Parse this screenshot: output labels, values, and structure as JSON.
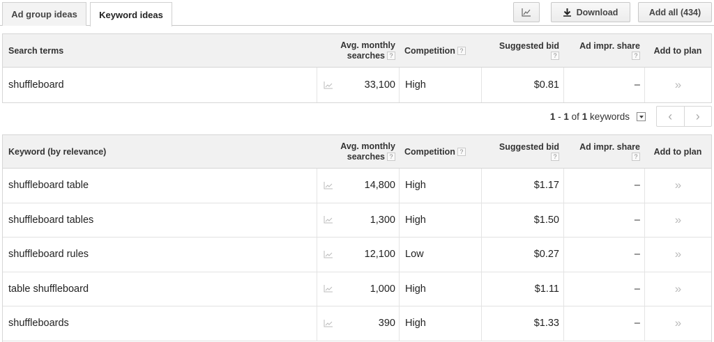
{
  "tabs": [
    {
      "label": "Ad group ideas",
      "active": false
    },
    {
      "label": "Keyword ideas",
      "active": true
    }
  ],
  "toolbar": {
    "chart_icon": "line-chart-icon",
    "download_label": "Download",
    "download_icon": "download-icon",
    "add_all_label": "Add all (434)"
  },
  "columns": {
    "search_terms": "Search terms",
    "keyword": "Keyword (by relevance)",
    "avg_line1": "Avg. monthly",
    "avg_line2": "searches",
    "competition": "Competition",
    "bid": "Suggested bid",
    "impr": "Ad impr. share",
    "add": "Add to plan",
    "help": "?"
  },
  "search_terms": [
    {
      "term": "shuffleboard",
      "avg": "33,100",
      "competition": "High",
      "bid": "$0.81",
      "impr": "–",
      "add": "»"
    }
  ],
  "pagination": {
    "range_start": "1",
    "sep": " - ",
    "range_end": "1",
    "of_label": "of",
    "total": "1",
    "unit": "keywords"
  },
  "keywords": [
    {
      "term": "shuffleboard table",
      "avg": "14,800",
      "competition": "High",
      "bid": "$1.17",
      "impr": "–",
      "add": "»"
    },
    {
      "term": "shuffleboard tables",
      "avg": "1,300",
      "competition": "High",
      "bid": "$1.50",
      "impr": "–",
      "add": "»"
    },
    {
      "term": "shuffleboard rules",
      "avg": "12,100",
      "competition": "Low",
      "bid": "$0.27",
      "impr": "–",
      "add": "»"
    },
    {
      "term": "table shuffleboard",
      "avg": "1,000",
      "competition": "High",
      "bid": "$1.11",
      "impr": "–",
      "add": "»"
    },
    {
      "term": "shuffleboards",
      "avg": "390",
      "competition": "High",
      "bid": "$1.33",
      "impr": "–",
      "add": "»"
    }
  ]
}
